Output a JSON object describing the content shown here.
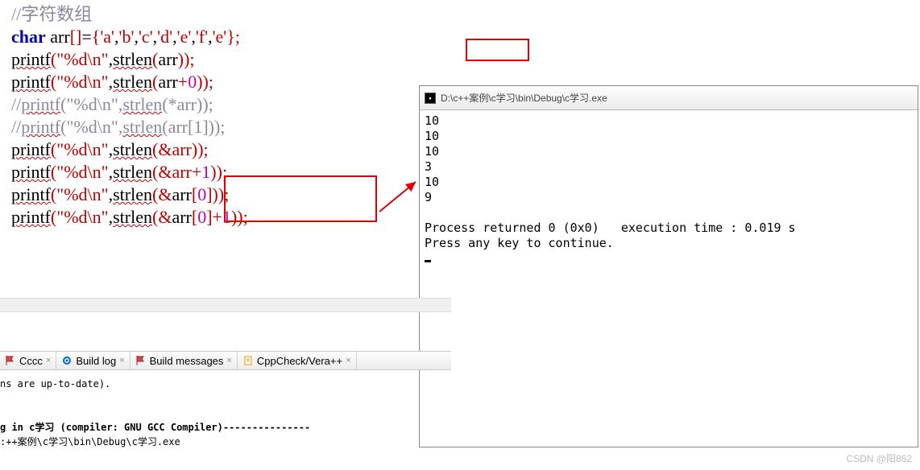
{
  "code": {
    "line1_comment": "//字符数组",
    "char_kw": "char",
    "arr_decl": " arr",
    "brackets_open": "[]",
    "eq": "=",
    "brace_open": "{",
    "chars": [
      "'a'",
      "'b'",
      "'c'",
      "'d'",
      "'e'",
      "'f'",
      "'e'"
    ],
    "brace_close": "}",
    "semi": ";",
    "printf": "printf",
    "fmt": "\"%d\\n\"",
    "strlen": "strlen",
    "arr_id": "arr",
    "plus0": "+",
    "zero": "0",
    "one": "1",
    "star": "*",
    "amp": "&",
    "sub0": "[",
    "sub1": "]",
    "comment_line3": "//printf(\"%d\\n\",strlen(*arr));",
    "comment_line4": "//printf(\"%d\\n\",strlen(arr[1]));"
  },
  "console": {
    "title": "D:\\c++案例\\c学习\\bin\\Debug\\c学习.exe",
    "lines": [
      "10",
      "10",
      "10",
      "3",
      "10",
      "9",
      "",
      "Process returned 0 (0x0)   execution time : 0.019 s",
      "Press any key to continue."
    ]
  },
  "tabs": {
    "t1": "Cccc",
    "t2": "Build log",
    "t3": "Build messages",
    "t4": "CppCheck/Vera++"
  },
  "build": {
    "line1": "ns are up-to-date).",
    "line2": "g in c学习 (compiler: GNU GCC Compiler)---------------",
    "line3": ":++案例\\c学习\\bin\\Debug\\c学习.exe"
  },
  "watermark": "CSDN @阳862"
}
